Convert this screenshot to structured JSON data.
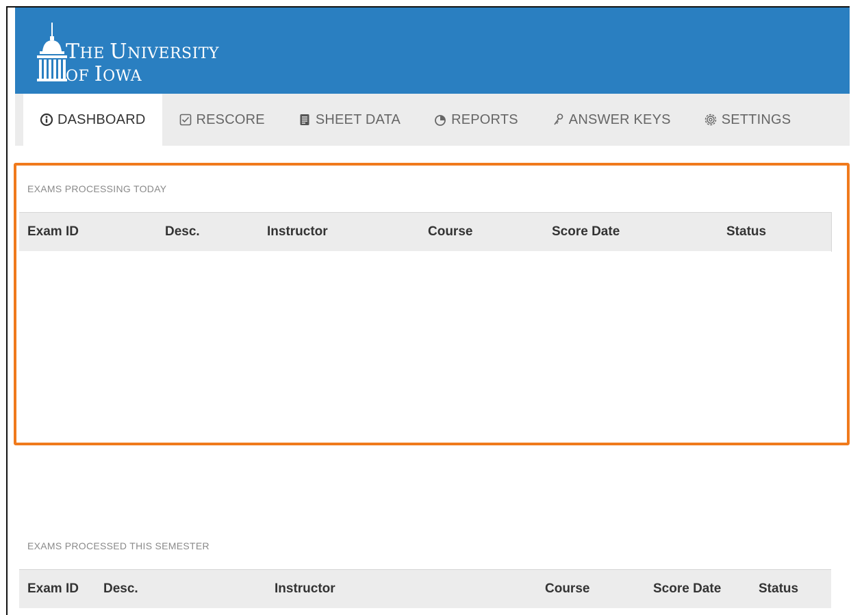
{
  "header": {
    "brand_line1_cap": "T",
    "brand_line1_rest": "HE ",
    "brand_line1_cap2": "U",
    "brand_line1_rest2": "NIVERSITY",
    "brand_line2_a": "OF ",
    "brand_line2_cap": "I",
    "brand_line2_rest": "OWA",
    "logo_icon": "old-capitol-dome-icon",
    "background": "#2a7fc1"
  },
  "nav": {
    "items": [
      {
        "label": "DASHBOARD",
        "icon": "info-circle-icon",
        "active": true
      },
      {
        "label": "RESCORE",
        "icon": "checkbox-icon",
        "active": false
      },
      {
        "label": "SHEET DATA",
        "icon": "document-icon",
        "active": false
      },
      {
        "label": "REPORTS",
        "icon": "pie-chart-icon",
        "active": false
      },
      {
        "label": "ANSWER KEYS",
        "icon": "key-icon",
        "active": false
      },
      {
        "label": "SETTINGS",
        "icon": "gear-icon",
        "active": false
      }
    ]
  },
  "today": {
    "title": "EXAMS PROCESSING TODAY",
    "columns": [
      "Exam ID",
      "Desc.",
      "Instructor",
      "Course",
      "Score Date",
      "Status"
    ],
    "rows": []
  },
  "semester": {
    "title": "EXAMS PROCESSED THIS SEMESTER",
    "columns": [
      "Exam ID",
      "Desc.",
      "Instructor",
      "Course",
      "Score Date",
      "Status"
    ],
    "rows": []
  },
  "colors": {
    "highlight": "#f07a1c",
    "nav_bg": "#ececec",
    "table_head_bg": "#ececec"
  }
}
